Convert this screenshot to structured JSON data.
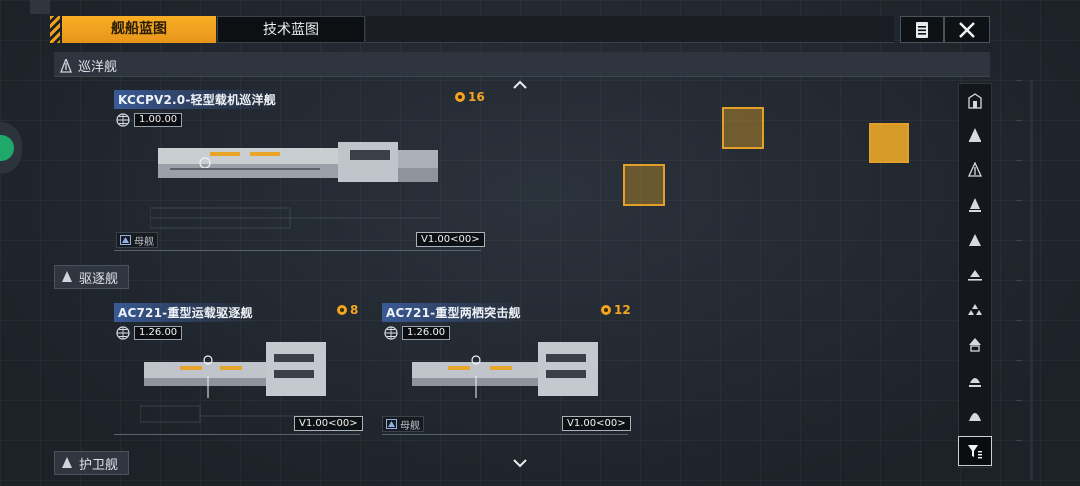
{
  "header": {
    "tabs": [
      {
        "label": "舰船蓝图",
        "active": true
      },
      {
        "label": "技术蓝图",
        "active": false
      }
    ],
    "icons": {
      "notes": "notes-icon",
      "close": "close-icon"
    }
  },
  "sections": {
    "cruiser": {
      "label": "巡洋舰"
    },
    "destroyer": {
      "label": "驱逐舰"
    },
    "frigate": {
      "label": "护卫舰"
    }
  },
  "ships": [
    {
      "name": "KCCPV2.0-轻型载机巡洋舰",
      "version": "1.00.00",
      "cost": "16",
      "role": "母舰",
      "badge": "V1.00<00>"
    },
    {
      "name": "AC721-重型运载驱逐舰",
      "version": "1.26.00",
      "cost": "8",
      "badge": "V1.00<00>"
    },
    {
      "name": "AC721-重型两栖突击舰",
      "version": "1.26.00",
      "cost": "12",
      "role": "母舰",
      "badge": "V1.00<00>"
    }
  ],
  "sidebar": {
    "icons": [
      "class-1-icon",
      "class-2-icon",
      "class-3-icon",
      "class-4-icon",
      "class-5-icon",
      "class-6-icon",
      "class-7-icon",
      "class-8-icon",
      "class-9-icon",
      "class-10-icon"
    ],
    "filter_icon": "filter-icon"
  },
  "colors": {
    "accent": "#f5a623",
    "name_bg": "#3a5a96",
    "marker": "#e2a02a"
  }
}
